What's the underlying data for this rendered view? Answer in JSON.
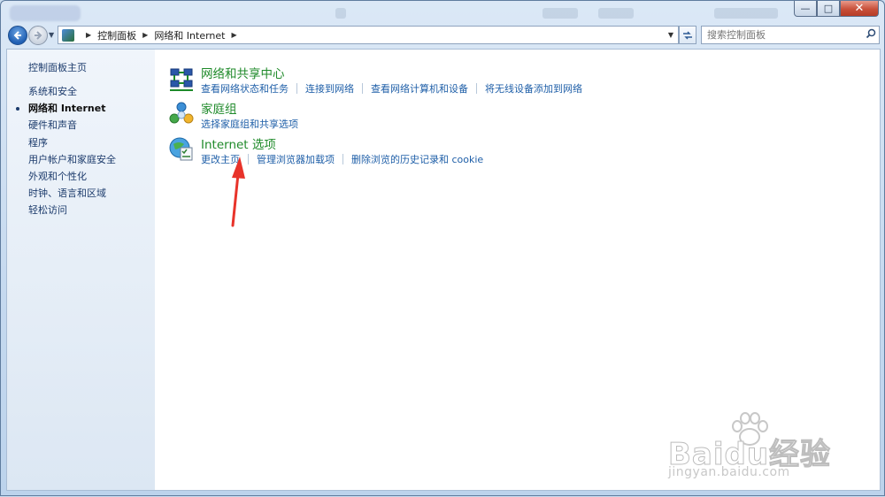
{
  "window": {
    "controls": {
      "minimize": "—",
      "maximize": "□",
      "close": "✕"
    }
  },
  "nav": {
    "back_icon": "back-arrow-icon",
    "forward_icon": "forward-arrow-icon",
    "breadcrumb": [
      "控制面板",
      "网络和 Internet"
    ],
    "search_placeholder": "搜索控制面板"
  },
  "sidebar": {
    "home": "控制面板主页",
    "items": [
      {
        "label": "系统和安全",
        "active": false
      },
      {
        "label": "网络和 Internet",
        "active": true
      },
      {
        "label": "硬件和声音",
        "active": false
      },
      {
        "label": "程序",
        "active": false
      },
      {
        "label": "用户帐户和家庭安全",
        "active": false
      },
      {
        "label": "外观和个性化",
        "active": false
      },
      {
        "label": "时钟、语言和区域",
        "active": false
      },
      {
        "label": "轻松访问",
        "active": false
      }
    ]
  },
  "categories": [
    {
      "title": "网络和共享中心",
      "icon": "network-sharing-icon",
      "links": [
        "查看网络状态和任务",
        "连接到网络",
        "查看网络计算机和设备",
        "将无线设备添加到网络"
      ]
    },
    {
      "title": "家庭组",
      "icon": "homegroup-icon",
      "links": [
        "选择家庭组和共享选项"
      ]
    },
    {
      "title": "Internet 选项",
      "icon": "internet-options-icon",
      "links": [
        "更改主页",
        "管理浏览器加载项",
        "删除浏览的历史记录和 cookie"
      ]
    }
  ],
  "watermark": {
    "main": "Baidu经验",
    "sub": "jingyan.baidu.com"
  },
  "colors": {
    "link": "#1f5fa8",
    "title": "#1f8a2a",
    "arrow": "#e8332a"
  }
}
